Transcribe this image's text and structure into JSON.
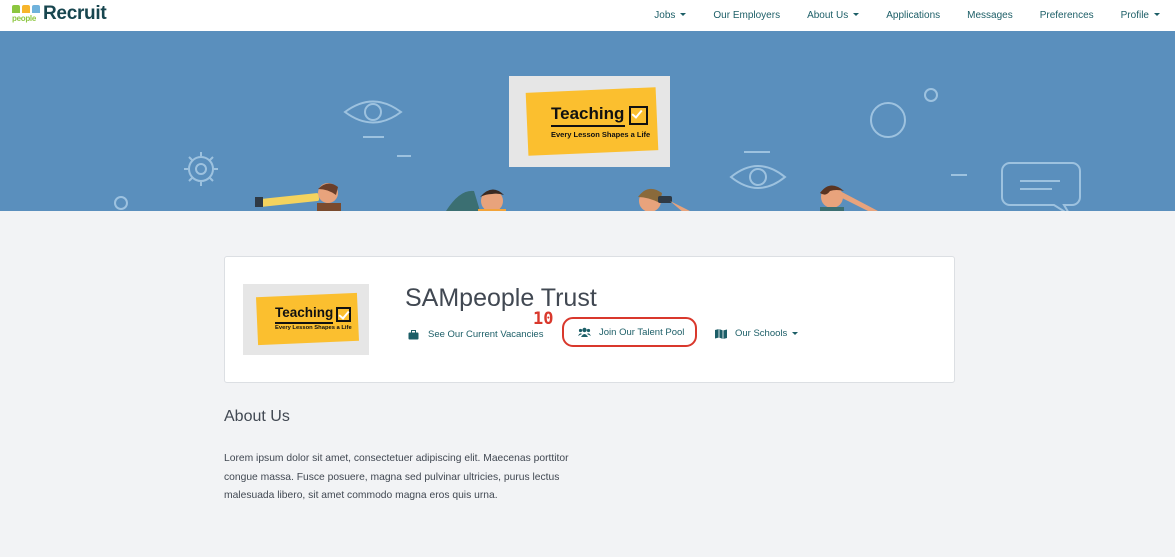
{
  "brand": {
    "mark_sub": "people",
    "name": "Recruit"
  },
  "nav": {
    "items": [
      {
        "label": "Jobs",
        "dropdown": true
      },
      {
        "label": "Our Employers",
        "dropdown": false
      },
      {
        "label": "About Us",
        "dropdown": true
      },
      {
        "label": "Applications",
        "dropdown": false
      },
      {
        "label": "Messages",
        "dropdown": false
      },
      {
        "label": "Preferences",
        "dropdown": false
      },
      {
        "label": "Profile",
        "dropdown": true
      }
    ]
  },
  "logo": {
    "title": "Teaching",
    "tagline": "Every Lesson Shapes a Life"
  },
  "profile": {
    "org_name": "SAMpeople Trust",
    "actions": {
      "vacancies": {
        "label": "See Our Current Vacancies",
        "icon": "briefcase-icon"
      },
      "talent_pool": {
        "label": "Join Our Talent Pool",
        "icon": "users-icon"
      },
      "schools": {
        "label": "Our Schools",
        "icon": "map-icon"
      }
    }
  },
  "annotation": {
    "step": "10"
  },
  "about": {
    "title": "About Us",
    "text": "Lorem ipsum dolor sit amet, consectetuer adipiscing elit. Maecenas porttitor congue massa. Fusce posuere, magna sed pulvinar ultricies, purus lectus malesuada libero, sit amet commodo magna eros quis urna."
  },
  "colors": {
    "banner": "#5a8fbd",
    "accent_teal": "#1c5e67",
    "logo_yellow": "#fbbf2f",
    "highlight_red": "#d9382c"
  }
}
